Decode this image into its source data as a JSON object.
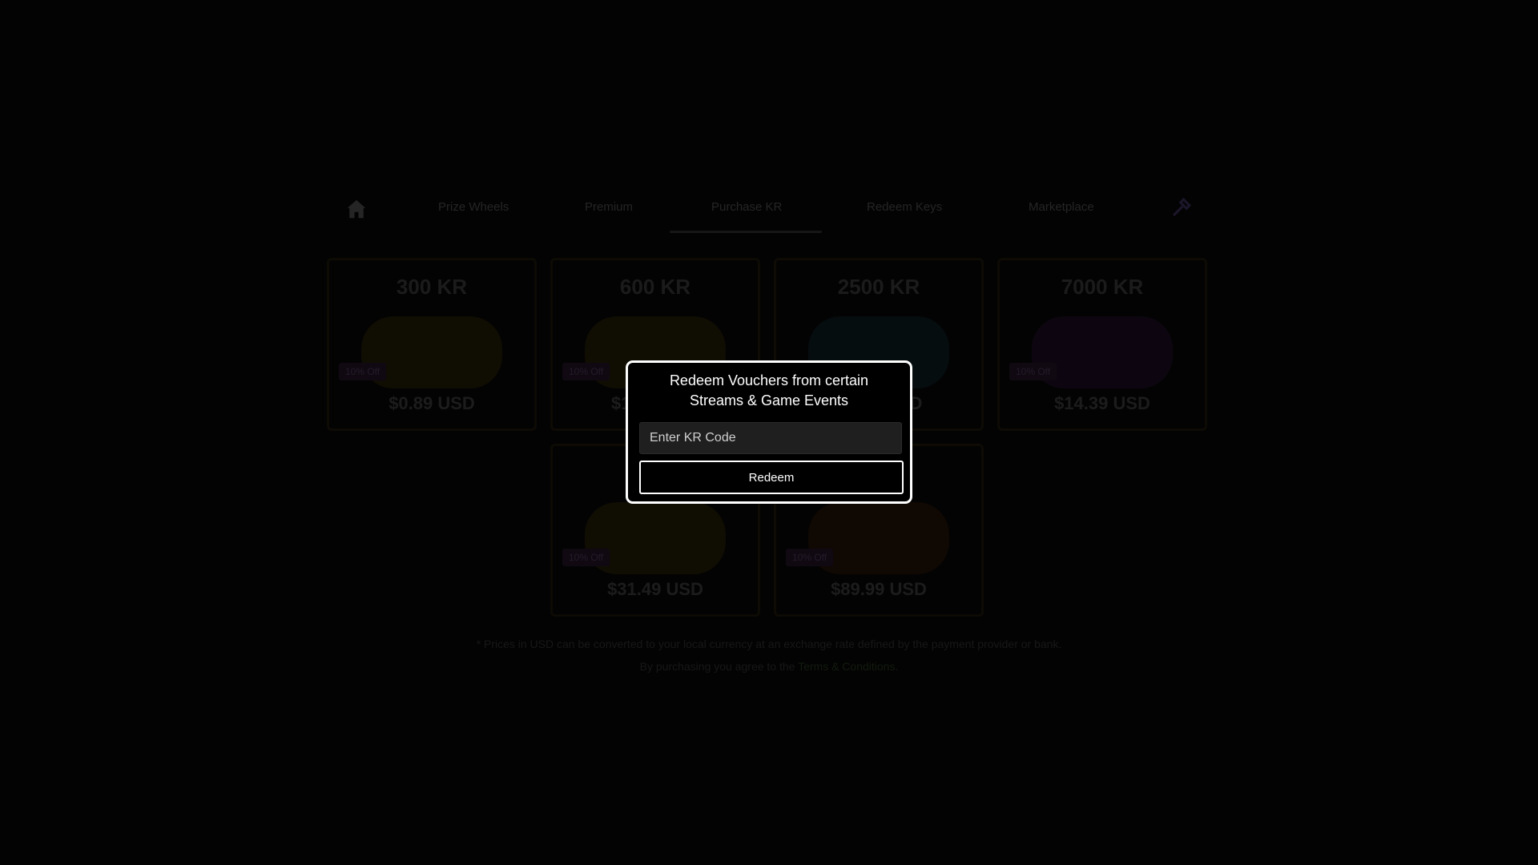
{
  "nav": {
    "home_icon": "home-icon",
    "items": [
      {
        "label": "Prize Wheels"
      },
      {
        "label": "Premium"
      },
      {
        "label": "Purchase KR"
      },
      {
        "label": "Redeem Keys"
      },
      {
        "label": "Marketplace"
      }
    ],
    "active_item": "Purchase KR",
    "tool_icon": "wrench-icon"
  },
  "products": [
    {
      "amount": "300 KR",
      "badge": "10% Off",
      "price": "$0.89 USD",
      "accent": "#1a1406"
    },
    {
      "amount": "600 KR",
      "badge": "10% Off",
      "price": "$1.?? USD",
      "accent": "#1a1406"
    },
    {
      "amount": "2500 KR",
      "badge": "",
      "price": "$?.79 USD",
      "accent": "#0a1418"
    },
    {
      "amount": "7000 KR",
      "badge": "10% Off",
      "price": "$14.39 USD",
      "accent": "#140a1a"
    },
    {
      "amount": "",
      "badge": "10% Off",
      "price": "$31.49 USD",
      "accent": "#1a1406"
    },
    {
      "amount": "",
      "badge": "10% Off",
      "price": "$89.99 USD",
      "accent": "#1a0d06"
    }
  ],
  "footer": {
    "note": "* Prices in USD can be converted to your local currency at an exchange rate defined by the payment provider or bank.",
    "terms_prefix": "By purchasing you agree to the",
    "terms_link": "Terms & Conditions."
  },
  "modal": {
    "title_line1": "Redeem Vouchers from certain",
    "title_line2": "Streams & Game Events",
    "input_placeholder": "Enter KR Code",
    "button_label": "Redeem"
  }
}
